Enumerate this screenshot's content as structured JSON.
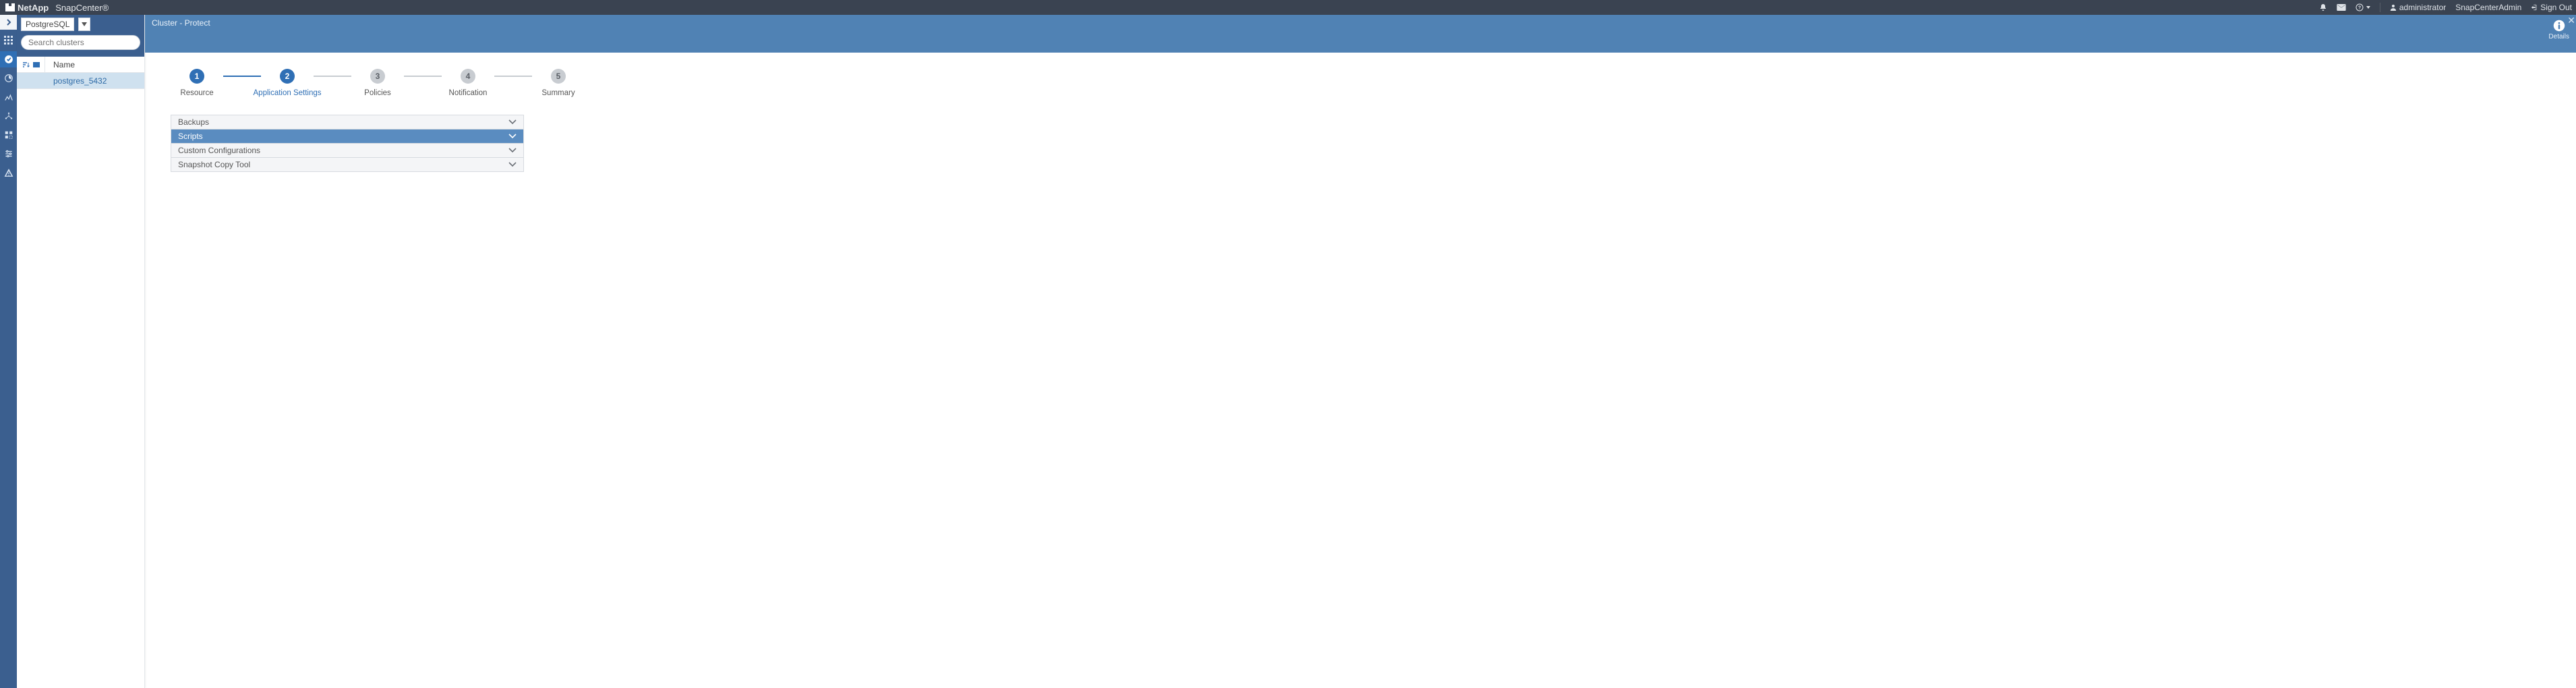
{
  "brand": {
    "logo_text": "NetApp",
    "product": "SnapCenter®"
  },
  "topbar": {
    "user": "administrator",
    "role": "SnapCenterAdmin",
    "signout": "Sign Out"
  },
  "side": {
    "category": "PostgreSQL",
    "search_placeholder": "Search clusters",
    "columns": {
      "name": "Name"
    },
    "items": [
      {
        "label": "postgres_5432"
      }
    ]
  },
  "breadcrumb": "Cluster - Protect",
  "details_label": "Details",
  "wizard": {
    "steps": [
      {
        "num": "1",
        "label": "Resource",
        "state": "done"
      },
      {
        "num": "2",
        "label": "Application Settings",
        "state": "done",
        "active": true
      },
      {
        "num": "3",
        "label": "Policies",
        "state": "pending"
      },
      {
        "num": "4",
        "label": "Notification",
        "state": "pending"
      },
      {
        "num": "5",
        "label": "Summary",
        "state": "pending"
      }
    ]
  },
  "accordion": {
    "items": [
      {
        "title": "Backups",
        "selected": false
      },
      {
        "title": "Scripts",
        "selected": true
      },
      {
        "title": "Custom Configurations",
        "selected": false
      },
      {
        "title": "Snapshot Copy Tool",
        "selected": false
      }
    ]
  }
}
